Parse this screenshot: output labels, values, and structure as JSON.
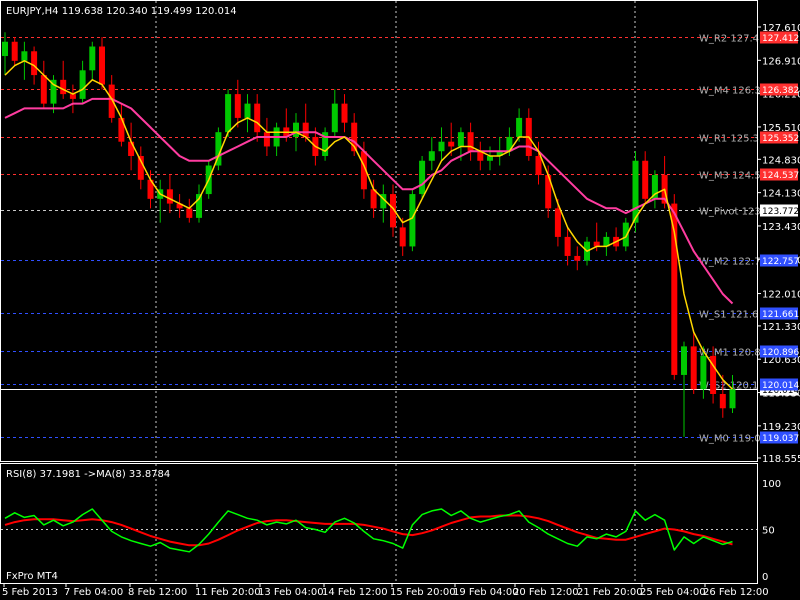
{
  "header": {
    "symbol_info": "EURJPY,H4  119.638 120.340 119.499 120.014"
  },
  "rsi_header": {
    "label": "RSI(8) 37.1981  ->MA(8) 33.8784"
  },
  "footer": {
    "broker": "FxPro MT4"
  },
  "colors": {
    "background": "#000000",
    "frame": "#ffffff",
    "grid": "#ffffff",
    "bull": "#00c800",
    "bear": "#ff0000",
    "ma_fast": "#ffd700",
    "ma_slow": "#ff3ca0",
    "rsi": "#00ff00",
    "rsi_ma": "#ff0000",
    "resistance": "#ff3030",
    "support": "#3050ff",
    "pivot": "#c8c8c8"
  },
  "chart_data": [
    {
      "type": "candlestick",
      "title": "EURJPY,H4",
      "ylim": [
        118.555,
        127.61
      ],
      "price_axis": [
        "127.610",
        "126.910",
        "126.210",
        "125.510",
        "124.830",
        "124.130",
        "123.430",
        "122.730",
        "122.010",
        "121.330",
        "120.630",
        "119.930",
        "119.230",
        "118.555"
      ],
      "time_axis": [
        "5 Feb 2013",
        "7 Feb 04:00",
        "8 Feb 12:00",
        "11 Feb 20:00",
        "13 Feb 04:00",
        "14 Feb 12:00",
        "15 Feb 20:00",
        "19 Feb 04:00",
        "20 Feb 12:00",
        "21 Feb 20:00",
        "25 Feb 04:00",
        "26 Feb 12:00"
      ],
      "levels": [
        {
          "name": "W_R2 127.4",
          "value": 127.4,
          "kind": "resistance",
          "tag": "127.412"
        },
        {
          "name": "W_M4 126.3",
          "value": 126.3,
          "kind": "resistance",
          "tag": "126.382"
        },
        {
          "name": "W_R1 125.3",
          "value": 125.3,
          "kind": "resistance",
          "tag": "125.352"
        },
        {
          "name": "W_M3 124.5",
          "value": 124.53,
          "kind": "resistance",
          "tag": "124.537"
        },
        {
          "name": "W_Pivot 123",
          "value": 123.77,
          "kind": "pivot",
          "tag": "123.772"
        },
        {
          "name": "W_M2 122.7",
          "value": 122.72,
          "kind": "support",
          "tag": "122.757"
        },
        {
          "name": "W_S1 121.6",
          "value": 121.6,
          "kind": "support",
          "tag": "121.661"
        },
        {
          "name": "W_M1 120.8",
          "value": 120.8,
          "kind": "support",
          "tag": "120.896"
        },
        {
          "name": "W_S2 120.1",
          "value": 120.1,
          "kind": "support",
          "tag": "120.014"
        },
        {
          "name": "W_M0 119.0",
          "value": 119.0,
          "kind": "support",
          "tag": "119.037"
        }
      ],
      "current_price": "120.014",
      "ohlc": [
        [
          127.0,
          127.5,
          126.6,
          127.3
        ],
        [
          127.3,
          127.4,
          126.8,
          126.9
        ],
        [
          126.9,
          127.3,
          126.5,
          127.1
        ],
        [
          127.1,
          127.2,
          126.4,
          126.6
        ],
        [
          126.6,
          126.9,
          125.9,
          126.0
        ],
        [
          126.0,
          126.6,
          125.8,
          126.5
        ],
        [
          126.5,
          126.9,
          126.1,
          126.2
        ],
        [
          126.2,
          126.4,
          125.8,
          126.1
        ],
        [
          126.1,
          126.9,
          126.0,
          126.7
        ],
        [
          126.7,
          127.3,
          126.5,
          127.2
        ],
        [
          127.2,
          127.4,
          126.3,
          126.4
        ],
        [
          126.4,
          126.6,
          125.6,
          125.7
        ],
        [
          125.7,
          126.0,
          125.1,
          125.2
        ],
        [
          125.2,
          125.6,
          124.6,
          124.9
        ],
        [
          124.9,
          125.1,
          124.2,
          124.4
        ],
        [
          124.4,
          124.6,
          123.8,
          124.0
        ],
        [
          124.0,
          124.4,
          123.5,
          124.2
        ],
        [
          124.2,
          124.5,
          123.7,
          123.9
        ],
        [
          123.9,
          124.1,
          123.6,
          123.8
        ],
        [
          123.8,
          124.0,
          123.5,
          123.6
        ],
        [
          123.6,
          124.3,
          123.5,
          124.1
        ],
        [
          124.1,
          124.8,
          124.0,
          124.7
        ],
        [
          124.7,
          125.5,
          124.6,
          125.4
        ],
        [
          125.4,
          126.3,
          125.3,
          126.2
        ],
        [
          126.2,
          126.5,
          125.5,
          125.7
        ],
        [
          125.7,
          126.2,
          125.4,
          126.0
        ],
        [
          126.0,
          126.2,
          125.2,
          125.4
        ],
        [
          125.4,
          125.7,
          124.9,
          125.1
        ],
        [
          125.1,
          125.6,
          124.9,
          125.5
        ],
        [
          125.5,
          125.9,
          125.2,
          125.3
        ],
        [
          125.3,
          125.8,
          125.0,
          125.6
        ],
        [
          125.6,
          126.0,
          125.2,
          125.3
        ],
        [
          125.3,
          125.5,
          124.7,
          124.9
        ],
        [
          124.9,
          125.5,
          124.8,
          125.4
        ],
        [
          125.4,
          126.3,
          125.3,
          126.0
        ],
        [
          126.0,
          126.2,
          125.4,
          125.6
        ],
        [
          125.6,
          125.8,
          124.9,
          125.0
        ],
        [
          125.0,
          125.2,
          124.0,
          124.2
        ],
        [
          124.2,
          124.4,
          123.6,
          123.8
        ],
        [
          123.8,
          124.3,
          123.5,
          124.1
        ],
        [
          124.1,
          124.3,
          123.2,
          123.4
        ],
        [
          123.4,
          123.6,
          122.8,
          123.0
        ],
        [
          123.0,
          124.2,
          122.9,
          124.1
        ],
        [
          124.1,
          124.9,
          124.0,
          124.8
        ],
        [
          124.8,
          125.3,
          124.6,
          125.0
        ],
        [
          125.0,
          125.5,
          124.8,
          125.2
        ],
        [
          125.2,
          125.6,
          124.9,
          125.1
        ],
        [
          125.1,
          125.5,
          124.8,
          125.4
        ],
        [
          125.4,
          125.6,
          124.8,
          125.0
        ],
        [
          125.0,
          125.2,
          124.6,
          124.8
        ],
        [
          124.8,
          125.1,
          124.6,
          124.9
        ],
        [
          124.9,
          125.3,
          124.7,
          125.0
        ],
        [
          125.0,
          125.5,
          124.9,
          125.3
        ],
        [
          125.3,
          125.9,
          125.2,
          125.7
        ],
        [
          125.7,
          125.9,
          124.8,
          124.9
        ],
        [
          124.9,
          125.2,
          124.3,
          124.5
        ],
        [
          124.5,
          124.7,
          123.6,
          123.8
        ],
        [
          123.8,
          124.0,
          123.0,
          123.2
        ],
        [
          123.2,
          123.4,
          122.6,
          122.8
        ],
        [
          122.8,
          123.0,
          122.5,
          122.7
        ],
        [
          122.7,
          123.2,
          122.6,
          123.1
        ],
        [
          123.1,
          123.5,
          122.9,
          123.0
        ],
        [
          123.0,
          123.3,
          122.8,
          123.2
        ],
        [
          123.2,
          123.4,
          122.9,
          123.0
        ],
        [
          123.0,
          123.6,
          122.9,
          123.5
        ],
        [
          123.5,
          125.0,
          123.3,
          124.8
        ],
        [
          124.8,
          125.0,
          123.9,
          124.0
        ],
        [
          124.0,
          124.6,
          123.8,
          124.5
        ],
        [
          124.5,
          124.9,
          123.8,
          123.9
        ],
        [
          123.9,
          124.1,
          120.2,
          120.3
        ],
        [
          120.3,
          121.0,
          119.0,
          120.9
        ],
        [
          120.9,
          121.2,
          119.9,
          120.0
        ],
        [
          120.0,
          120.9,
          119.8,
          120.7
        ],
        [
          120.7,
          120.9,
          119.7,
          119.9
        ],
        [
          119.9,
          120.3,
          119.4,
          119.6
        ],
        [
          119.6,
          120.3,
          119.5,
          120.0
        ]
      ],
      "ma_fast": [
        126.6,
        126.8,
        126.9,
        126.8,
        126.6,
        126.4,
        126.3,
        126.2,
        126.3,
        126.5,
        126.4,
        126.1,
        125.7,
        125.2,
        124.8,
        124.4,
        124.1,
        124.0,
        123.9,
        123.8,
        124.0,
        124.4,
        124.9,
        125.4,
        125.6,
        125.7,
        125.6,
        125.4,
        125.4,
        125.4,
        125.4,
        125.3,
        125.1,
        125.0,
        125.2,
        125.3,
        125.1,
        124.7,
        124.2,
        124.0,
        123.8,
        123.5,
        123.6,
        124.0,
        124.4,
        124.8,
        125.0,
        125.1,
        125.1,
        125.0,
        124.9,
        124.9,
        125.0,
        125.3,
        125.3,
        125.0,
        124.5,
        123.9,
        123.4,
        123.1,
        122.9,
        123.0,
        123.0,
        123.1,
        123.2,
        123.6,
        123.9,
        124.1,
        124.2,
        123.3,
        122.0,
        121.2,
        120.8,
        120.5,
        120.2,
        120.0
      ],
      "ma_slow": [
        125.7,
        125.8,
        125.9,
        125.9,
        125.9,
        125.9,
        125.9,
        126.0,
        126.0,
        126.1,
        126.1,
        126.1,
        126.0,
        125.9,
        125.7,
        125.5,
        125.3,
        125.1,
        124.9,
        124.8,
        124.8,
        124.8,
        124.9,
        125.0,
        125.1,
        125.2,
        125.3,
        125.3,
        125.3,
        125.3,
        125.4,
        125.4,
        125.4,
        125.3,
        125.3,
        125.3,
        125.2,
        125.0,
        124.8,
        124.6,
        124.4,
        124.2,
        124.2,
        124.3,
        124.5,
        124.6,
        124.8,
        124.9,
        125.0,
        125.0,
        125.0,
        125.0,
        125.0,
        125.1,
        125.1,
        125.0,
        124.8,
        124.6,
        124.4,
        124.2,
        124.0,
        123.9,
        123.8,
        123.8,
        123.7,
        123.8,
        123.9,
        124.0,
        124.0,
        123.7,
        123.3,
        122.9,
        122.6,
        122.3,
        122.0,
        121.8
      ]
    },
    {
      "type": "line",
      "title": "RSI(8) 37.1981  ->MA(8) 33.8784",
      "ylim": [
        0,
        100
      ],
      "y_ticks": [
        "100",
        "50",
        "0"
      ],
      "level_lines": [
        50
      ],
      "series": [
        {
          "name": "RSI(8)",
          "values": [
            62,
            68,
            63,
            65,
            55,
            60,
            54,
            58,
            66,
            72,
            60,
            48,
            42,
            38,
            35,
            32,
            36,
            30,
            28,
            26,
            34,
            45,
            58,
            70,
            66,
            62,
            60,
            55,
            58,
            56,
            60,
            52,
            50,
            47,
            58,
            62,
            57,
            48,
            40,
            38,
            35,
            30,
            55,
            66,
            70,
            72,
            65,
            70,
            62,
            58,
            61,
            64,
            66,
            70,
            58,
            52,
            45,
            40,
            35,
            32,
            42,
            40,
            45,
            42,
            48,
            70,
            60,
            66,
            60,
            28,
            42,
            35,
            42,
            38,
            34,
            37
          ]
        },
        {
          "name": "MA(8)",
          "values": [
            55,
            58,
            60,
            61,
            61,
            61,
            60,
            59,
            60,
            61,
            60,
            58,
            55,
            51,
            47,
            43,
            40,
            37,
            35,
            33,
            33,
            35,
            39,
            44,
            49,
            53,
            57,
            59,
            60,
            60,
            59,
            58,
            57,
            56,
            56,
            56,
            56,
            55,
            53,
            51,
            48,
            45,
            44,
            46,
            49,
            53,
            57,
            60,
            63,
            64,
            64,
            65,
            65,
            65,
            64,
            62,
            59,
            55,
            51,
            47,
            44,
            41,
            40,
            39,
            39,
            42,
            45,
            48,
            51,
            50,
            48,
            45,
            43,
            40,
            37,
            34
          ]
        }
      ]
    }
  ]
}
